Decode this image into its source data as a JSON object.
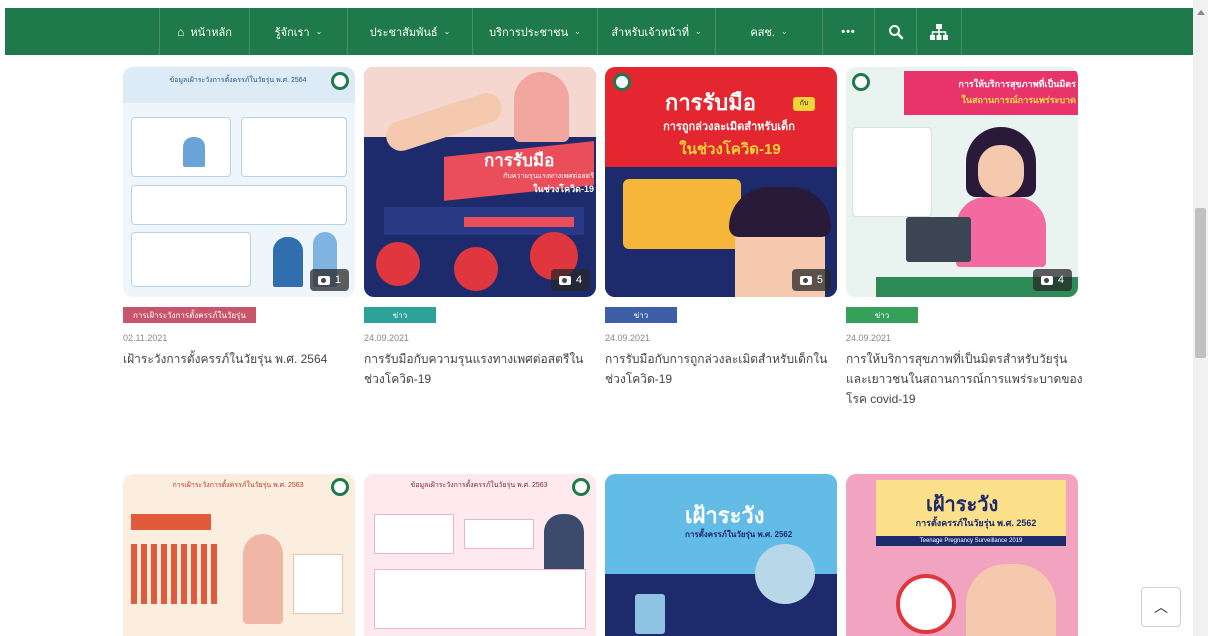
{
  "nav": {
    "items": [
      {
        "label": "หน้าหลัก",
        "icon": "home-icon",
        "dropdown": false
      },
      {
        "label": "รู้จักเรา",
        "dropdown": true
      },
      {
        "label": "ประชาสัมพันธ์",
        "dropdown": true
      },
      {
        "label": "บริการประชาชน",
        "dropdown": true
      },
      {
        "label": "สำหรับเจ้าหน้าที่",
        "dropdown": true
      },
      {
        "label": "คสช.",
        "dropdown": true
      }
    ],
    "more_label": "•••",
    "chevron": "⌄",
    "home_glyph": "⌂"
  },
  "cards": [
    {
      "tag": "การเฝ้าระวังการตั้งครรภ์ในวัยรุ่น",
      "tag_color": "#c8556b",
      "date": "02.11.2021",
      "title": "เฝ้าระวังการตั้งครรภ์ในวัยรุ่น พ.ศ. 2564",
      "count": "1",
      "thumb_text": [
        "ข้อมูลเฝ้าระวังการตั้งครรภ์ในวัยรุ่น พ.ศ. 2564"
      ]
    },
    {
      "tag": "ข่าว",
      "tag_color": "#2ba39a",
      "date": "24.09.2021",
      "title": "การรับมือกับความรุนแรงทางเพศต่อสตรีในช่วงโควิด-19",
      "count": "4",
      "thumb_text": [
        "การรับมือ",
        "กับความรุนแรงทางเพศต่อสตรี",
        "ในช่วงโควิด-19"
      ]
    },
    {
      "tag": "ข่าว",
      "tag_color": "#3e5ea8",
      "date": "24.09.2021",
      "title": "การรับมือกับการถูกล่วงละเมิดสำหรับเด็กในช่วงโควิด-19",
      "count": "5",
      "thumb_text": [
        "การรับมือ",
        "กับ",
        "การถูกล่วงละเมิดสำหรับเด็ก",
        "ในช่วงโควิด-19"
      ]
    },
    {
      "tag": "ข่าว",
      "tag_color": "#36a05a",
      "date": "24.09.2021",
      "title": "การให้บริการสุขภาพที่เป็นมิตรสำหรับวัยรุ่นและเยาวชนในสถานการณ์การแพร่ระบาดของโรค covid-19",
      "count": "4",
      "thumb_text": [
        "การให้บริการสุขภาพที่เป็นมิตร",
        "ในสถานการณ์การแพร่ระบาด"
      ]
    },
    {
      "thumb_text": [
        "การเฝ้าระวังการตั้งครรภ์ในวัยรุ่น พ.ศ. 2563"
      ]
    },
    {
      "thumb_text": [
        "ข้อมูลเฝ้าระวังการตั้งครรภ์ในวัยรุ่น พ.ศ. 2563"
      ]
    },
    {
      "thumb_text": [
        "เฝ้าระวัง",
        "การตั้งครรภ์ในวัยรุ่น พ.ศ. 2562"
      ]
    },
    {
      "thumb_text": [
        "เฝ้าระวัง",
        "การตั้งครรภ์ในวัยรุ่น พ.ศ. 2562",
        "Teenage Pregnancy Surveillance 2019"
      ]
    }
  ],
  "to_top_glyph": "︿"
}
